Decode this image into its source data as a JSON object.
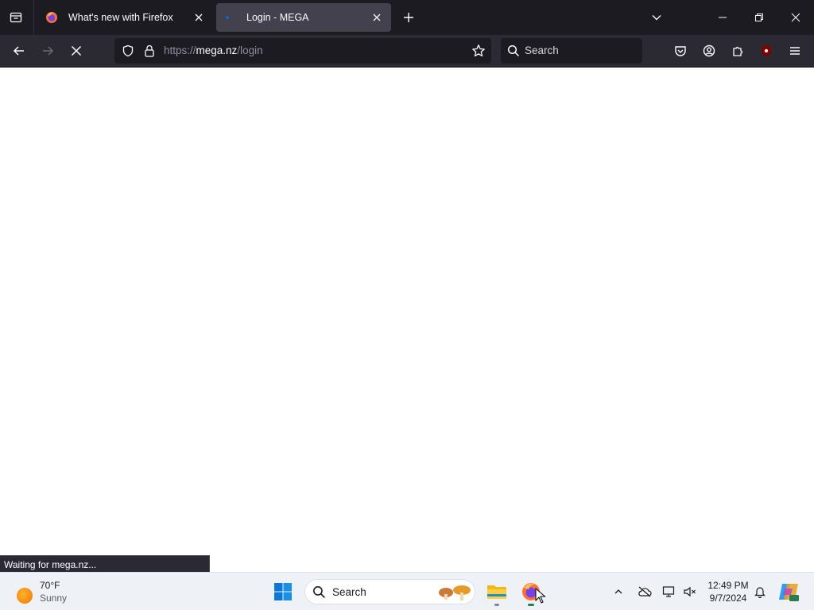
{
  "browser": {
    "tabs": [
      {
        "title": "What's new with Firefox",
        "favicon": "firefox-icon",
        "active": false
      },
      {
        "title": "Login - MEGA",
        "favicon": "mega-icon",
        "active": true
      }
    ],
    "url": {
      "scheme": "https://",
      "host": "mega.nz",
      "path": "/login"
    },
    "search_placeholder": "Search",
    "status_text": "Waiting for mega.nz...",
    "accent": "#1c1b22",
    "tab_active_bg": "#42414d"
  },
  "taskbar": {
    "weather": {
      "temp": "70°F",
      "condition": "Sunny"
    },
    "search_placeholder": "Search",
    "clock": {
      "time": "12:49 PM",
      "date": "9/7/2024"
    }
  }
}
